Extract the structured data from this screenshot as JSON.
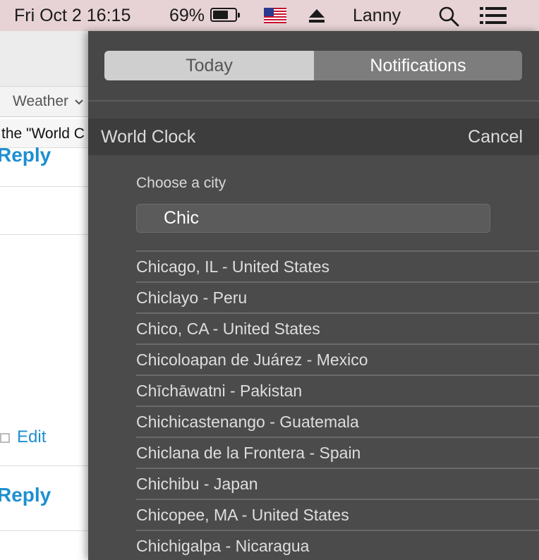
{
  "menubar": {
    "datetime": "Fri Oct 2  16:15",
    "battery_percent": "69%",
    "battery_level": 0.69,
    "user": "Lanny",
    "icons": [
      "battery-icon",
      "us-flag-icon",
      "eject-icon",
      "spotlight-search-icon",
      "notification-center-icon"
    ]
  },
  "background_app": {
    "tab_label": "Weather",
    "search_text": "the \"World C",
    "reply_label_1": "Reply",
    "edit_label": "Edit",
    "reply_label_2": "Reply"
  },
  "panel": {
    "tabs": [
      {
        "label": "Today",
        "selected": false
      },
      {
        "label": "Notifications",
        "selected": true
      }
    ],
    "widget": {
      "title": "World Clock",
      "cancel_label": "Cancel",
      "choose_label": "Choose a city",
      "search_value": "Chic",
      "results": [
        "Chicago, IL - United States",
        "Chiclayo - Peru",
        "Chico, CA - United States",
        "Chicoloapan de Juárez - Mexico",
        "Chīchāwatni - Pakistan",
        "Chichicastenango - Guatemala",
        "Chiclana de la Frontera - Spain",
        "Chichibu - Japan",
        "Chicopee, MA - United States",
        "Chichigalpa - Nicaragua"
      ]
    }
  },
  "colors": {
    "menubar_bg": "#e7d3d6",
    "panel_bg": "#474747",
    "link_blue": "#1d8fd0"
  }
}
